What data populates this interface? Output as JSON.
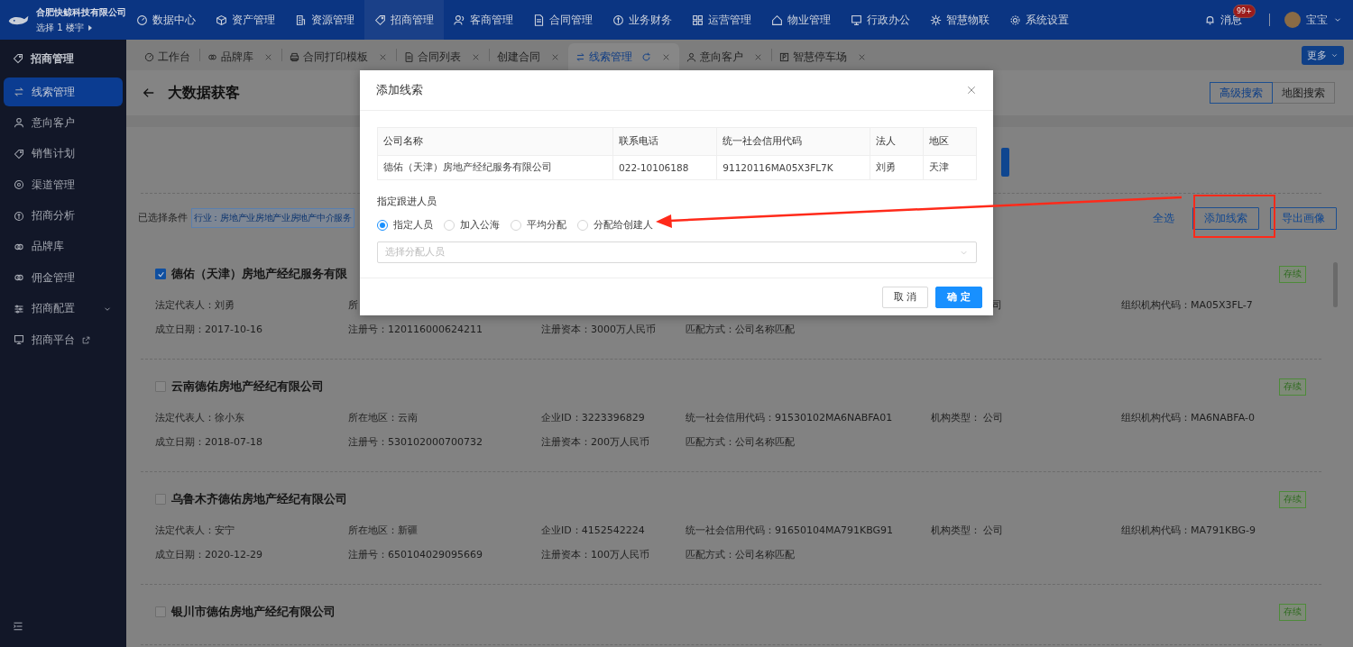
{
  "top_bar": {
    "company": "合肥快鲸科技有限公司",
    "building_selector": "选择 1 楼宇",
    "nav": [
      {
        "label": "数据中心",
        "selected": false
      },
      {
        "label": "资产管理",
        "selected": false
      },
      {
        "label": "资源管理",
        "selected": false
      },
      {
        "label": "招商管理",
        "selected": true
      },
      {
        "label": "客商管理",
        "selected": false
      },
      {
        "label": "合同管理",
        "selected": false
      },
      {
        "label": "业务财务",
        "selected": false
      },
      {
        "label": "运营管理",
        "selected": false
      },
      {
        "label": "物业管理",
        "selected": false
      },
      {
        "label": "行政办公",
        "selected": false
      },
      {
        "label": "智慧物联",
        "selected": false
      },
      {
        "label": "系统设置",
        "selected": false
      }
    ],
    "messages": {
      "label": "消息",
      "badge": "99+"
    },
    "user": {
      "name": "宝宝"
    }
  },
  "tabs": [
    {
      "label": "工作台",
      "closable": false,
      "selected": false
    },
    {
      "label": "品牌库",
      "closable": true,
      "selected": false
    },
    {
      "label": "合同打印模板",
      "closable": true,
      "selected": false
    },
    {
      "label": "合同列表",
      "closable": true,
      "selected": false
    },
    {
      "label": "创建合同",
      "closable": true,
      "selected": false
    },
    {
      "label": "线索管理",
      "closable": true,
      "selected": true
    },
    {
      "label": "意向客户",
      "closable": true,
      "selected": false
    },
    {
      "label": "智慧停车场",
      "closable": true,
      "selected": false
    }
  ],
  "more_button": "更多",
  "sidebar": {
    "title": "招商管理",
    "items": [
      {
        "label": "线索管理",
        "kind": "link",
        "selected": true
      },
      {
        "label": "意向客户",
        "kind": "link",
        "selected": false
      },
      {
        "label": "销售计划",
        "kind": "link",
        "selected": false
      },
      {
        "label": "渠道管理",
        "kind": "link",
        "selected": false
      },
      {
        "label": "招商分析",
        "kind": "link",
        "selected": false
      },
      {
        "label": "品牌库",
        "kind": "link",
        "selected": false
      },
      {
        "label": "佣金管理",
        "kind": "link",
        "selected": false
      },
      {
        "label": "招商配置",
        "kind": "group",
        "selected": false
      },
      {
        "label": "招商平台",
        "kind": "external",
        "selected": false
      }
    ]
  },
  "page": {
    "title": "大数据获客",
    "search_modes": [
      {
        "label": "高级搜索",
        "selected": true
      },
      {
        "label": "地图搜索",
        "selected": false
      }
    ]
  },
  "filter": {
    "label": "已选择条件",
    "tag": "行业：房地产业房地产业房地产中介服务",
    "select_all": "全选",
    "actions": [
      "添加线索",
      "导出画像"
    ]
  },
  "results": [
    {
      "title": "德佑（天津）房地产经纪服务有限",
      "checked": true,
      "status": "存续",
      "fields": {
        "legal_rep": "法定代表人：刘勇",
        "region": "所",
        "org_type_tail": "司",
        "org_code": "组织机构代码：MA05X3FL-7",
        "founded": "成立日期：2017-10-16",
        "reg_no": "注册号：120116000624211",
        "capital": "注册资本：3000万人民币",
        "match": "匹配方式：公司名称匹配"
      }
    },
    {
      "title": "云南德佑房地产经纪有限公司",
      "checked": false,
      "status": "存续",
      "fields": {
        "legal_rep": "法定代表人：徐小东",
        "region": "所在地区：云南",
        "enterprise_id": "企业ID：3223396829",
        "credit_code": "统一社会信用代码：91530102MA6NABFA01",
        "org_type": "机构类型：  公司",
        "org_code": "组织机构代码：MA6NABFA-0",
        "founded": "成立日期：2018-07-18",
        "reg_no": "注册号：530102000700732",
        "capital": "注册资本：200万人民币",
        "match": "匹配方式：公司名称匹配"
      }
    },
    {
      "title": "乌鲁木齐德佑房地产经纪有限公司",
      "checked": false,
      "status": "存续",
      "fields": {
        "legal_rep": "法定代表人：安宁",
        "region": "所在地区：新疆",
        "enterprise_id": "企业ID：4152542224",
        "credit_code": "统一社会信用代码：91650104MA791KBG91",
        "org_type": "机构类型：  公司",
        "org_code": "组织机构代码：MA791KBG-9",
        "founded": "成立日期：2020-12-29",
        "reg_no": "注册号：650104029095669",
        "capital": "注册资本：100万人民币",
        "match": "匹配方式：公司名称匹配"
      }
    },
    {
      "title": "银川市德佑房地产经纪有限公司",
      "checked": false,
      "status": "存续"
    }
  ],
  "dialog": {
    "title": "添加线索",
    "table": {
      "columns": [
        "公司名称",
        "联系电话",
        "统一社会信用代码",
        "法人",
        "地区"
      ],
      "rows": [
        [
          "德佑（天津）房地产经纪服务有限公司",
          "022-10106188",
          "91120116MA05X3FL7K",
          "刘勇",
          "天津"
        ]
      ]
    },
    "assign_label": "指定跟进人员",
    "options": [
      {
        "label": "指定人员",
        "selected": true
      },
      {
        "label": "加入公海",
        "selected": false
      },
      {
        "label": "平均分配",
        "selected": false
      },
      {
        "label": "分配给创建人",
        "selected": false
      }
    ],
    "assignee_select": {
      "placeholder": "选择分配人员"
    },
    "buttons": [
      {
        "label": "取 消",
        "kind": "default"
      },
      {
        "label": "确 定",
        "kind": "primary"
      }
    ]
  }
}
